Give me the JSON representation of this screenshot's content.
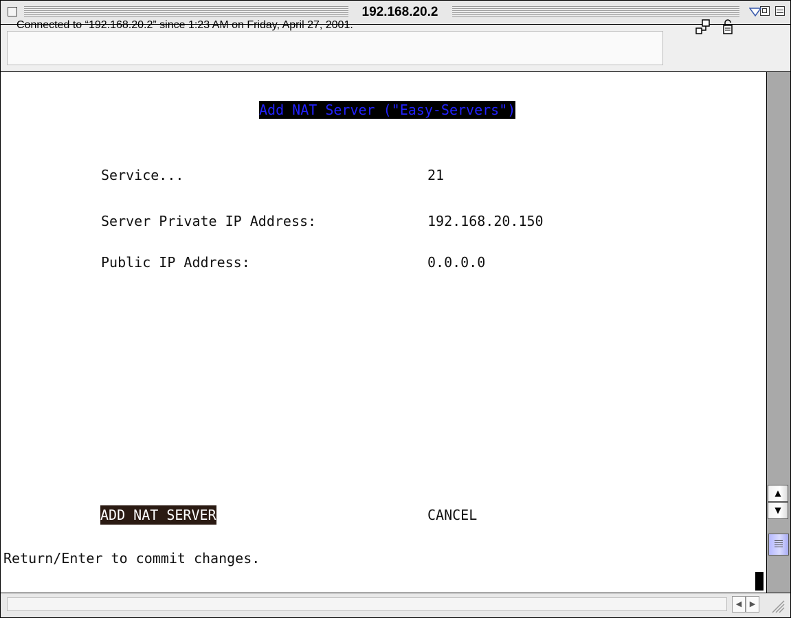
{
  "window": {
    "title": "192.168.20.2"
  },
  "status": {
    "text": "Connected to “192.168.20.2” since 1:23 AM on Friday, April 27, 2001.",
    "icons": [
      "network-icon",
      "lock-icon"
    ]
  },
  "terminal": {
    "heading": "Add NAT Server (\"Easy-Servers\")",
    "fields": [
      {
        "label": "Service...",
        "value": "21"
      },
      {
        "label": "Server Private IP Address:",
        "value": "192.168.20.150"
      },
      {
        "label": "Public IP Address:",
        "value": "0.0.0.0"
      }
    ],
    "add_button": "ADD NAT SERVER",
    "cancel_button": "CANCEL",
    "hint": "Return/Enter to commit changes."
  },
  "colors": {
    "heading_text": "#2222ff",
    "highlight_bg": "#000000",
    "scroll_thumb": "#c7c9ff"
  }
}
